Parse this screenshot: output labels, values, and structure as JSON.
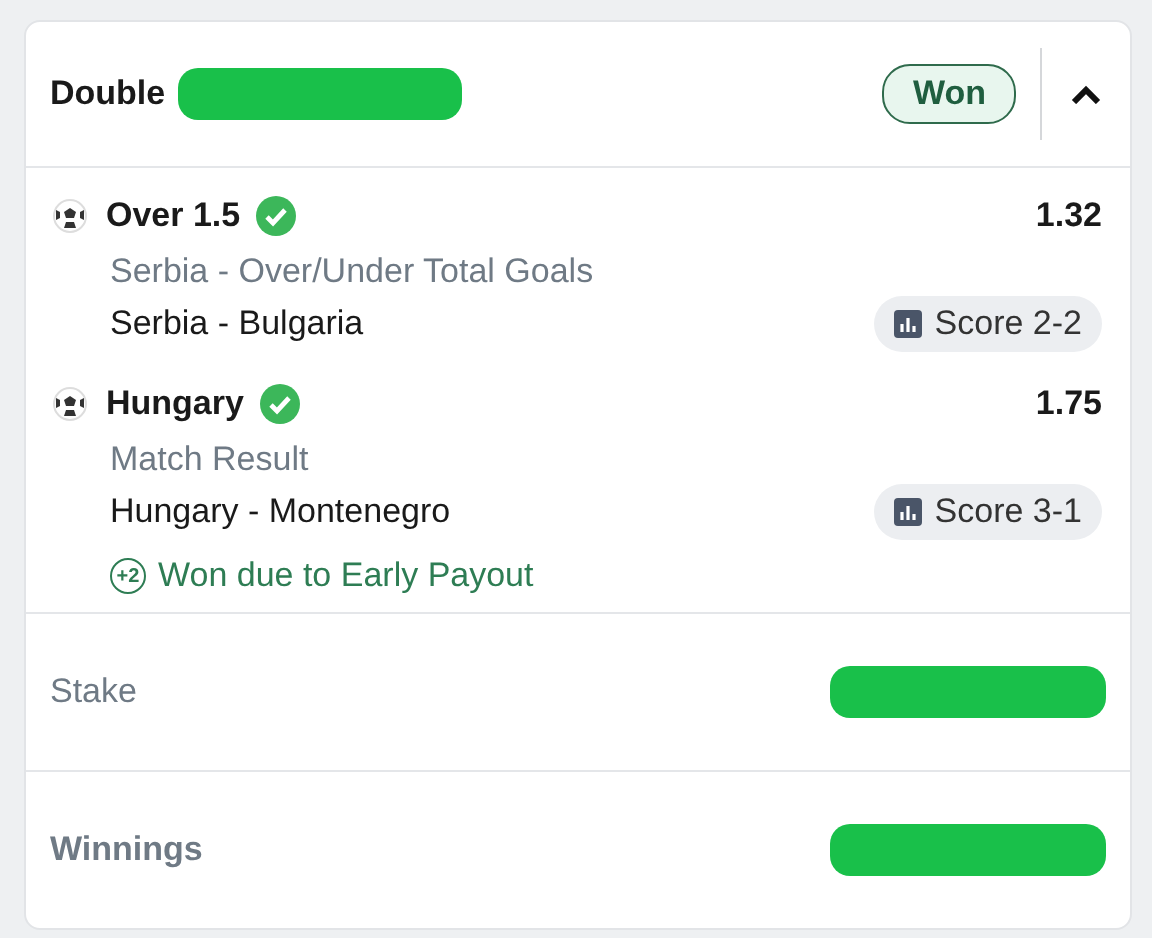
{
  "header": {
    "title": "Double",
    "title_redacted": true,
    "status": "Won",
    "expanded": true
  },
  "legs": [
    {
      "selection": "Over 1.5",
      "won": true,
      "odds": "1.32",
      "market": "Serbia - Over/Under Total Goals",
      "match": "Serbia - Bulgaria",
      "score": "Score 2-2"
    },
    {
      "selection": "Hungary",
      "won": true,
      "odds": "1.75",
      "market": "Match Result",
      "match": "Hungary - Montenegro",
      "score": "Score 3-1",
      "early_payout": {
        "icon": "+2",
        "text": "Won due to Early Payout"
      }
    }
  ],
  "summary": [
    {
      "label": "Stake",
      "bold": false,
      "redacted": true
    },
    {
      "label": "Winnings",
      "bold": true,
      "redacted": true
    }
  ]
}
